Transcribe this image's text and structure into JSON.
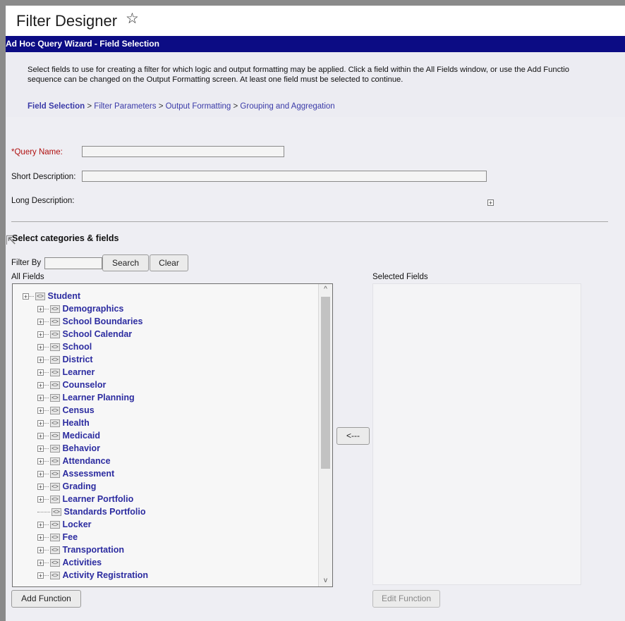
{
  "header": {
    "title": "Filter Designer",
    "favorite_icon": "star-outline-icon"
  },
  "wizard": {
    "title": "Ad Hoc Query Wizard - Field Selection"
  },
  "instructions": {
    "line1": "Select fields to use for creating a filter for which logic and output formatting may be applied. Click a field within the All Fields window, or use the Add Functio",
    "line2": "sequence can be changed on the Output Formatting screen. At least one field must be selected to continue."
  },
  "steps": [
    {
      "label": "Field Selection",
      "current": true
    },
    {
      "label": "Filter Parameters",
      "current": false
    },
    {
      "label": "Output Formatting",
      "current": false
    },
    {
      "label": "Grouping and Aggregation",
      "current": false
    }
  ],
  "steps_separator": ">",
  "form": {
    "query_name_label": "*Query Name:",
    "query_name_value": "",
    "short_description_label": "Short Description:",
    "short_description_value": "",
    "long_description_label": "Long Description:"
  },
  "fields": {
    "section_title": "Select categories & fields",
    "filter_by_label": "Filter By",
    "filter_by_value": "",
    "search_button": "Search",
    "clear_button": "Clear",
    "all_fields_label": "All Fields",
    "selected_fields_label": "Selected Fields",
    "move_button": "<---",
    "add_function_button": "Add Function",
    "edit_function_button": "Edit Function",
    "tree_root": "Student",
    "tree_items": [
      {
        "label": "Demographics",
        "expandable": true
      },
      {
        "label": "School Boundaries",
        "expandable": true
      },
      {
        "label": "School Calendar",
        "expandable": true
      },
      {
        "label": "School",
        "expandable": true
      },
      {
        "label": "District",
        "expandable": true
      },
      {
        "label": "Learner",
        "expandable": true
      },
      {
        "label": "Counselor",
        "expandable": true
      },
      {
        "label": "Learner Planning",
        "expandable": true
      },
      {
        "label": "Census",
        "expandable": true
      },
      {
        "label": "Health",
        "expandable": true
      },
      {
        "label": "Medicaid",
        "expandable": true
      },
      {
        "label": "Behavior",
        "expandable": true
      },
      {
        "label": "Attendance",
        "expandable": true
      },
      {
        "label": "Assessment",
        "expandable": true
      },
      {
        "label": "Grading",
        "expandable": true
      },
      {
        "label": "Learner Portfolio",
        "expandable": true
      },
      {
        "label": "Standards Portfolio",
        "expandable": false
      },
      {
        "label": "Locker",
        "expandable": true
      },
      {
        "label": "Fee",
        "expandable": true
      },
      {
        "label": "Transportation",
        "expandable": true
      },
      {
        "label": "Activities",
        "expandable": true
      },
      {
        "label": "Activity Registration",
        "expandable": true
      }
    ]
  },
  "colors": {
    "wizard_bar": "#0c0c84",
    "link": "#2c2ca0",
    "required": "#b01010"
  }
}
